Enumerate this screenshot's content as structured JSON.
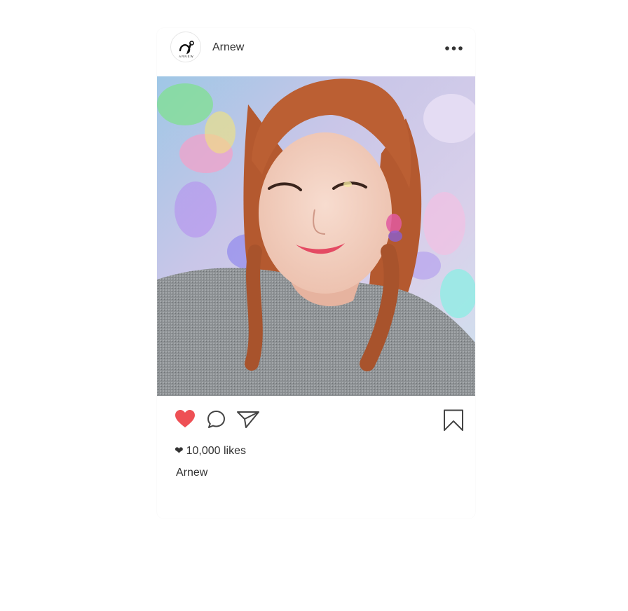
{
  "post": {
    "username": "Arnew",
    "logo_text": "ARNEW",
    "likes_text": "10,000 likes",
    "caption_username": "Arnew",
    "more_icon": "more-horizontal-icon",
    "heart_icon": "heart-icon",
    "comment_icon": "comment-icon",
    "share_icon": "paper-plane-icon",
    "bookmark_icon": "bookmark-icon"
  },
  "colors": {
    "liked_heart": "#ee5055",
    "text": "#333333",
    "icon_stroke": "#444444"
  }
}
